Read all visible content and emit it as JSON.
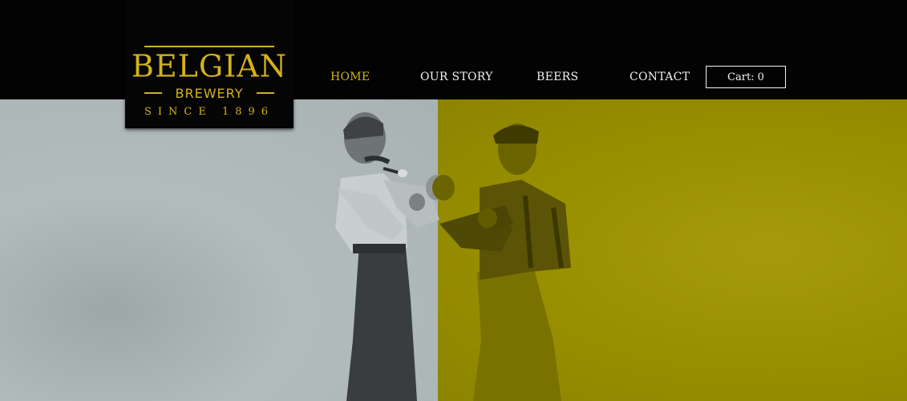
{
  "logo": {
    "brand": "BELGIAN",
    "sub": "BREWERY",
    "since": "SINCE 1896"
  },
  "nav": {
    "items": [
      {
        "label": "HOME",
        "active": true
      },
      {
        "label": "OUR STORY",
        "active": false
      },
      {
        "label": "BEERS",
        "active": false
      },
      {
        "label": "CONTACT",
        "active": false
      }
    ],
    "cart_label": "Cart: 0"
  },
  "hero": {
    "image": "two-boxers-photo"
  },
  "colors": {
    "accent": "#d4b21a",
    "header_bg": "#030303",
    "hero_left": "#aab3b4",
    "hero_right": "#9a9100"
  }
}
